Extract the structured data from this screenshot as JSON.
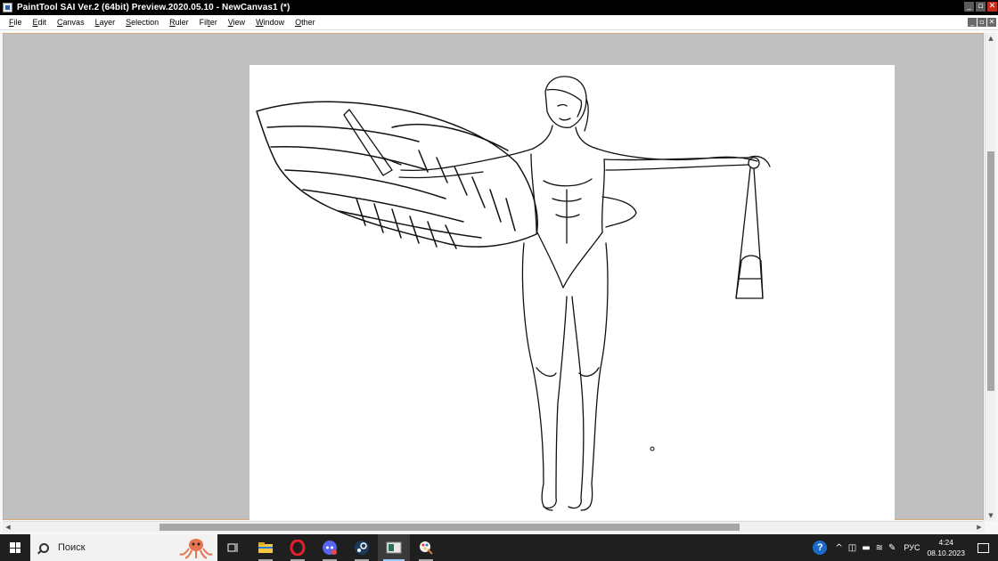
{
  "window": {
    "title": "PaintTool SAI Ver.2 (64bit) Preview.2020.05.10 - NewCanvas1 (*)",
    "controls": [
      "_",
      "▫",
      "✕"
    ]
  },
  "menu": {
    "items": [
      {
        "accel": "F",
        "rest": "ile"
      },
      {
        "accel": "E",
        "rest": "dit"
      },
      {
        "accel": "C",
        "rest": "anvas"
      },
      {
        "accel": "L",
        "rest": "ayer"
      },
      {
        "accel": "S",
        "rest": "election"
      },
      {
        "accel": "R",
        "rest": "uler"
      },
      {
        "pre": "Fil",
        "accel": "t",
        "rest": "er"
      },
      {
        "accel": "V",
        "rest": "iew"
      },
      {
        "accel": "W",
        "rest": "indow"
      },
      {
        "accel": "O",
        "rest": "ther"
      }
    ],
    "mdi_controls": [
      "_",
      "▫",
      "✕"
    ]
  },
  "taskbar": {
    "search_placeholder": "Поиск",
    "apps": [
      {
        "icon": "task-view-icon",
        "state": "normal"
      },
      {
        "icon": "file-explorer-icon",
        "state": "running"
      },
      {
        "icon": "opera-icon",
        "state": "running"
      },
      {
        "icon": "discord-icon",
        "state": "running"
      },
      {
        "icon": "steam-icon",
        "state": "running"
      },
      {
        "icon": "painttool-sai-icon",
        "state": "active"
      },
      {
        "icon": "paint-app-icon",
        "state": "running"
      }
    ],
    "tray": {
      "language": "РУС",
      "time": "4:24",
      "date": "08.10.2023"
    }
  },
  "colors": {
    "titlebar": "#000000",
    "workspace": "#c0c0c0",
    "canvas": "#ffffff",
    "taskbar": "#1f1f1f",
    "accent": "#9cc7ff"
  }
}
